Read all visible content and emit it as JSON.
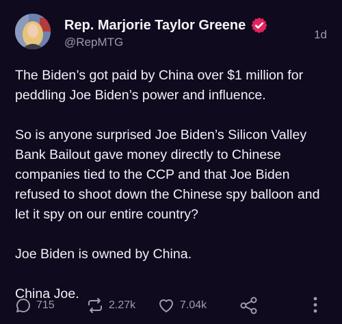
{
  "post": {
    "author": {
      "display_name": "Rep. Marjorie Taylor Greene",
      "handle": "@RepMTG",
      "verified_color": "#e0245e"
    },
    "time": "1d",
    "paragraphs": [
      "The Biden’s got paid by China over $1 million for peddling Joe Biden’s power and influence.",
      "So is anyone surprised Joe Biden’s Silicon Valley Bank Bailout gave money directly to Chinese companies tied to the CCP and that Joe Biden refused to shoot down the Chinese spy balloon and let it spy on our entire country?",
      "Joe Biden is owned by China.",
      "China Joe."
    ],
    "actions": {
      "replies": "715",
      "reposts": "2.27k",
      "likes": "7.04k"
    }
  },
  "icons": [
    "reply-icon",
    "repost-icon",
    "like-icon",
    "share-icon",
    "more-icon",
    "verified-icon"
  ]
}
